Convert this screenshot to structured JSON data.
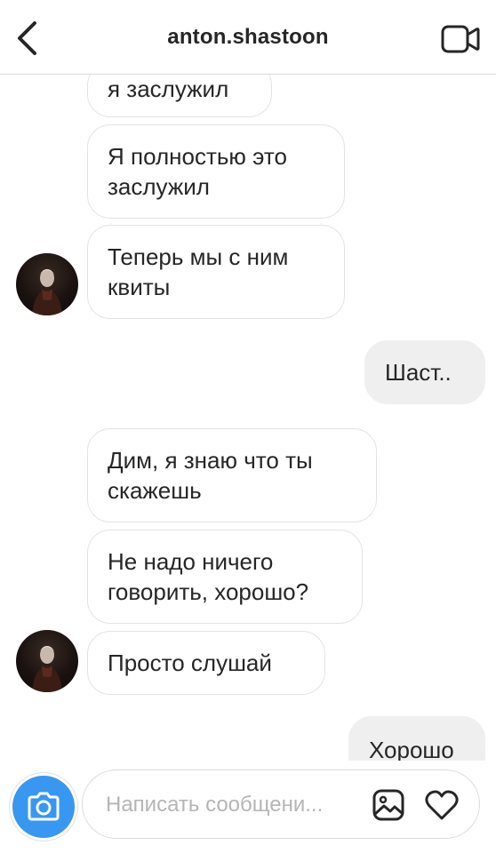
{
  "header": {
    "title": "anton.shastoon",
    "back_icon": "chevron-left-icon",
    "video_icon": "video-camera-icon"
  },
  "messages": [
    {
      "direction": "in",
      "text": "я заслужил"
    },
    {
      "direction": "in",
      "text": "Я полностью это заслужил"
    },
    {
      "direction": "in",
      "text": "Теперь мы с ним квиты"
    },
    {
      "direction": "out",
      "text": "Шаст.."
    },
    {
      "direction": "in",
      "text": "Дим, я знаю что ты скажешь"
    },
    {
      "direction": "in",
      "text": "Не надо ничего говорить, хорошо?"
    },
    {
      "direction": "in",
      "text": "Просто слушай"
    },
    {
      "direction": "out",
      "text": "Хорошо"
    }
  ],
  "composer": {
    "placeholder": "Написать сообщени...",
    "camera_icon": "camera-icon",
    "gallery_icon": "gallery-icon",
    "heart_icon": "heart-icon"
  },
  "colors": {
    "accent": "#3897f0",
    "outgoing_bubble": "#efefef",
    "incoming_border": "#e3e3e3",
    "text": "#262626",
    "placeholder": "#b5b5b5"
  }
}
